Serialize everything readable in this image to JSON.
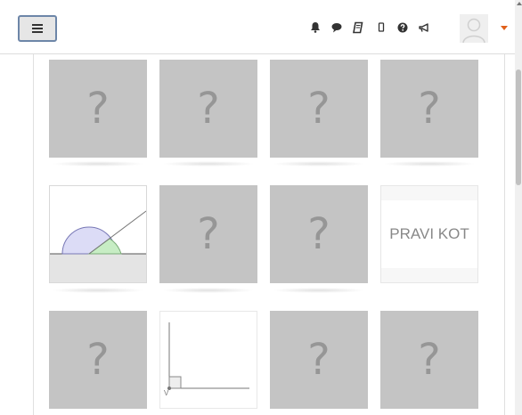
{
  "navbar": {
    "menu_button": "toggle-navigation",
    "icons": [
      "bell-icon",
      "chat-icon",
      "book-icon",
      "mobile-icon",
      "help-icon",
      "megaphone-icon"
    ],
    "accent_color": "#e0601a"
  },
  "game": {
    "hidden_symbol": "?",
    "rows": [
      [
        {
          "state": "hidden"
        },
        {
          "state": "hidden"
        },
        {
          "state": "hidden"
        },
        {
          "state": "hidden"
        }
      ],
      [
        {
          "state": "revealed-image",
          "image": "half-circle-angle-diagram"
        },
        {
          "state": "hidden"
        },
        {
          "state": "hidden"
        },
        {
          "state": "revealed-text",
          "text": "PRAVI KOT"
        }
      ],
      [
        {
          "state": "hidden"
        },
        {
          "state": "revealed-image",
          "image": "right-angle-diagram"
        },
        {
          "state": "hidden"
        },
        {
          "state": "hidden"
        }
      ]
    ],
    "right_angle_vertex_label": "V"
  }
}
